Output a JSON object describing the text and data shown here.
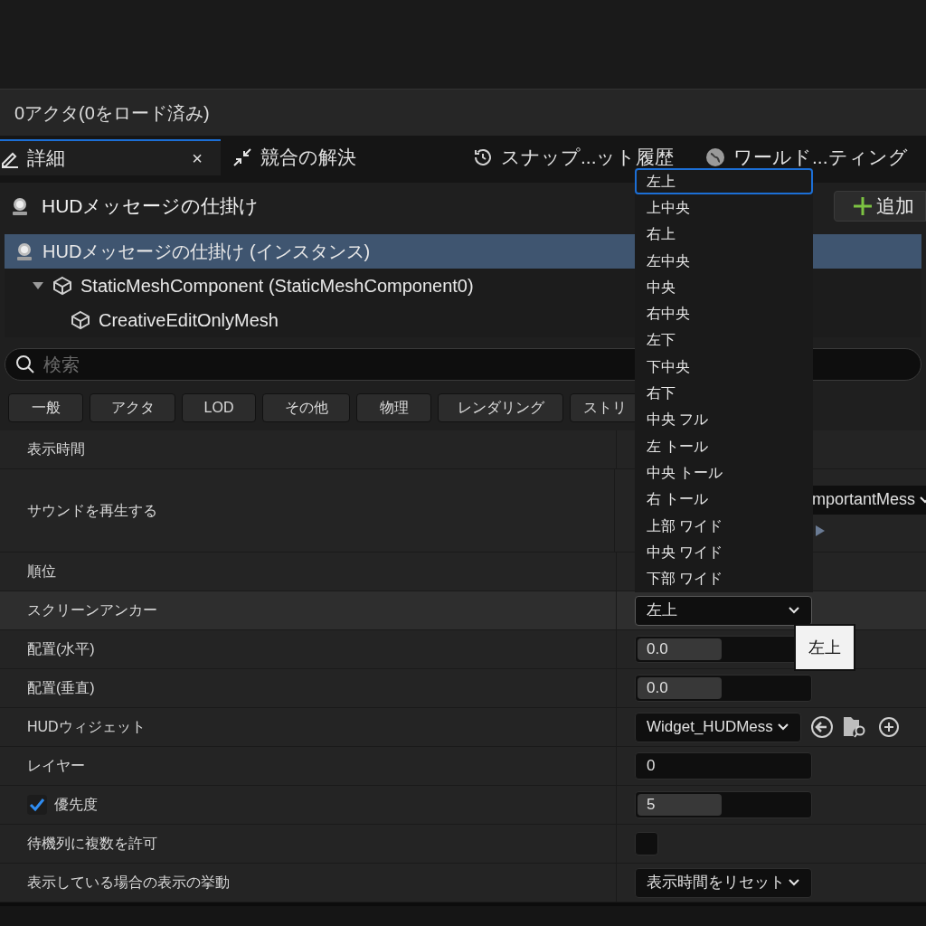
{
  "status": "0アクタ(0をロード済み)",
  "tabs": [
    {
      "label": "詳細",
      "selected": true,
      "close": "×"
    },
    {
      "label": "競合の解決",
      "selected": false
    },
    {
      "label": "スナップ...ット履歴",
      "selected": false
    },
    {
      "label": "ワールド...ティング",
      "selected": false
    }
  ],
  "header": {
    "title": "HUDメッセージの仕掛け",
    "add_button": "追加"
  },
  "tree": [
    {
      "label": "HUDメッセージの仕掛け (インスタンス)",
      "selected": true,
      "kind": "actor",
      "children": [
        {
          "label": "StaticMeshComponent (StaticMeshComponent0)",
          "selected": false,
          "expanded": true,
          "kind": "mesh",
          "children": [
            {
              "label": "CreativeEditOnlyMesh",
              "selected": false,
              "kind": "mesh"
            }
          ]
        }
      ]
    }
  ],
  "search": {
    "placeholder": "検索"
  },
  "filters": [
    "一般",
    "アクタ",
    "LOD",
    "その他",
    "物理",
    "レンダリング",
    "ストリ"
  ],
  "properties": [
    {
      "label": "表示時間",
      "kind": "none"
    },
    {
      "label": "サウンドを再生する",
      "kind": "partial",
      "value": "mportantMess"
    },
    {
      "label": "順位",
      "kind": "none"
    },
    {
      "label": "スクリーンアンカー",
      "kind": "dropdown",
      "value": "左上",
      "selected": true
    },
    {
      "label": "配置(水平)",
      "kind": "slider",
      "value": "0.0",
      "level": 0.48
    },
    {
      "label": "配置(垂直)",
      "kind": "slider",
      "value": "0.0",
      "level": 0.48
    },
    {
      "label": "HUDウィジェット",
      "kind": "asset",
      "value": "Widget_HUDMess"
    },
    {
      "label": "レイヤー",
      "kind": "text",
      "value": "0"
    },
    {
      "label": "優先度",
      "kind": "slider",
      "value": "5",
      "level": 0.48,
      "checked": true
    },
    {
      "label": "待機列に複数を許可",
      "kind": "checkbox",
      "checked": false
    },
    {
      "label": "表示している場合の表示の挙動",
      "kind": "dropdown",
      "value": "表示時間をリセット"
    }
  ],
  "menu": [
    {
      "label": "左上",
      "selected": true
    },
    {
      "label": "上中央",
      "selected": false
    },
    {
      "label": "右上",
      "selected": false
    },
    {
      "label": "左中央",
      "selected": false
    },
    {
      "label": "中央",
      "selected": false
    },
    {
      "label": "右中央",
      "selected": false
    },
    {
      "label": "左下",
      "selected": false
    },
    {
      "label": "下中央",
      "selected": false
    },
    {
      "label": "右下",
      "selected": false
    },
    {
      "label": "中央 フル",
      "selected": false
    },
    {
      "label": "左 トール",
      "selected": false
    },
    {
      "label": "中央 トール",
      "selected": false
    },
    {
      "label": "右 トール",
      "selected": false
    },
    {
      "label": "上部 ワイド",
      "selected": false
    },
    {
      "label": "中央 ワイド",
      "selected": false
    },
    {
      "label": "下部 ワイド",
      "selected": false
    }
  ],
  "tooltip": "左上"
}
